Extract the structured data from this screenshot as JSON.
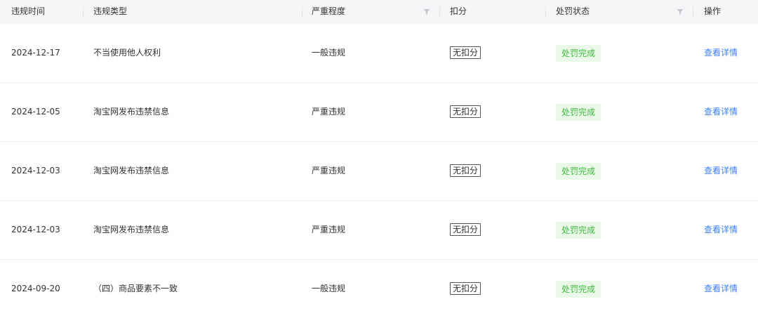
{
  "header": {
    "col_time": "违规时间",
    "col_type": "违规类型",
    "col_severity": "严重程度",
    "col_deduct": "扣分",
    "col_status": "处罚状态",
    "col_action": "操作"
  },
  "rows": [
    {
      "time": "2024-12-17",
      "type": "不当使用他人权利",
      "severity": "一般违规",
      "deduct": "无扣分",
      "status": "处罚完成",
      "action": "查看详情"
    },
    {
      "time": "2024-12-05",
      "type": "淘宝网发布违禁信息",
      "severity": "严重违规",
      "deduct": "无扣分",
      "status": "处罚完成",
      "action": "查看详情"
    },
    {
      "time": "2024-12-03",
      "type": "淘宝网发布违禁信息",
      "severity": "严重违规",
      "deduct": "无扣分",
      "status": "处罚完成",
      "action": "查看详情"
    },
    {
      "time": "2024-12-03",
      "type": "淘宝网发布违禁信息",
      "severity": "严重违规",
      "deduct": "无扣分",
      "status": "处罚完成",
      "action": "查看详情"
    },
    {
      "time": "2024-09-20",
      "type": "（四）商品要素不一致",
      "severity": "一般违规",
      "deduct": "无扣分",
      "status": "处罚完成",
      "action": "查看详情"
    }
  ],
  "colors": {
    "header_bg": "#f5f6f8",
    "status_text": "#3dbd3d",
    "status_bg": "#eaf8ea",
    "link": "#3d7ff0"
  }
}
